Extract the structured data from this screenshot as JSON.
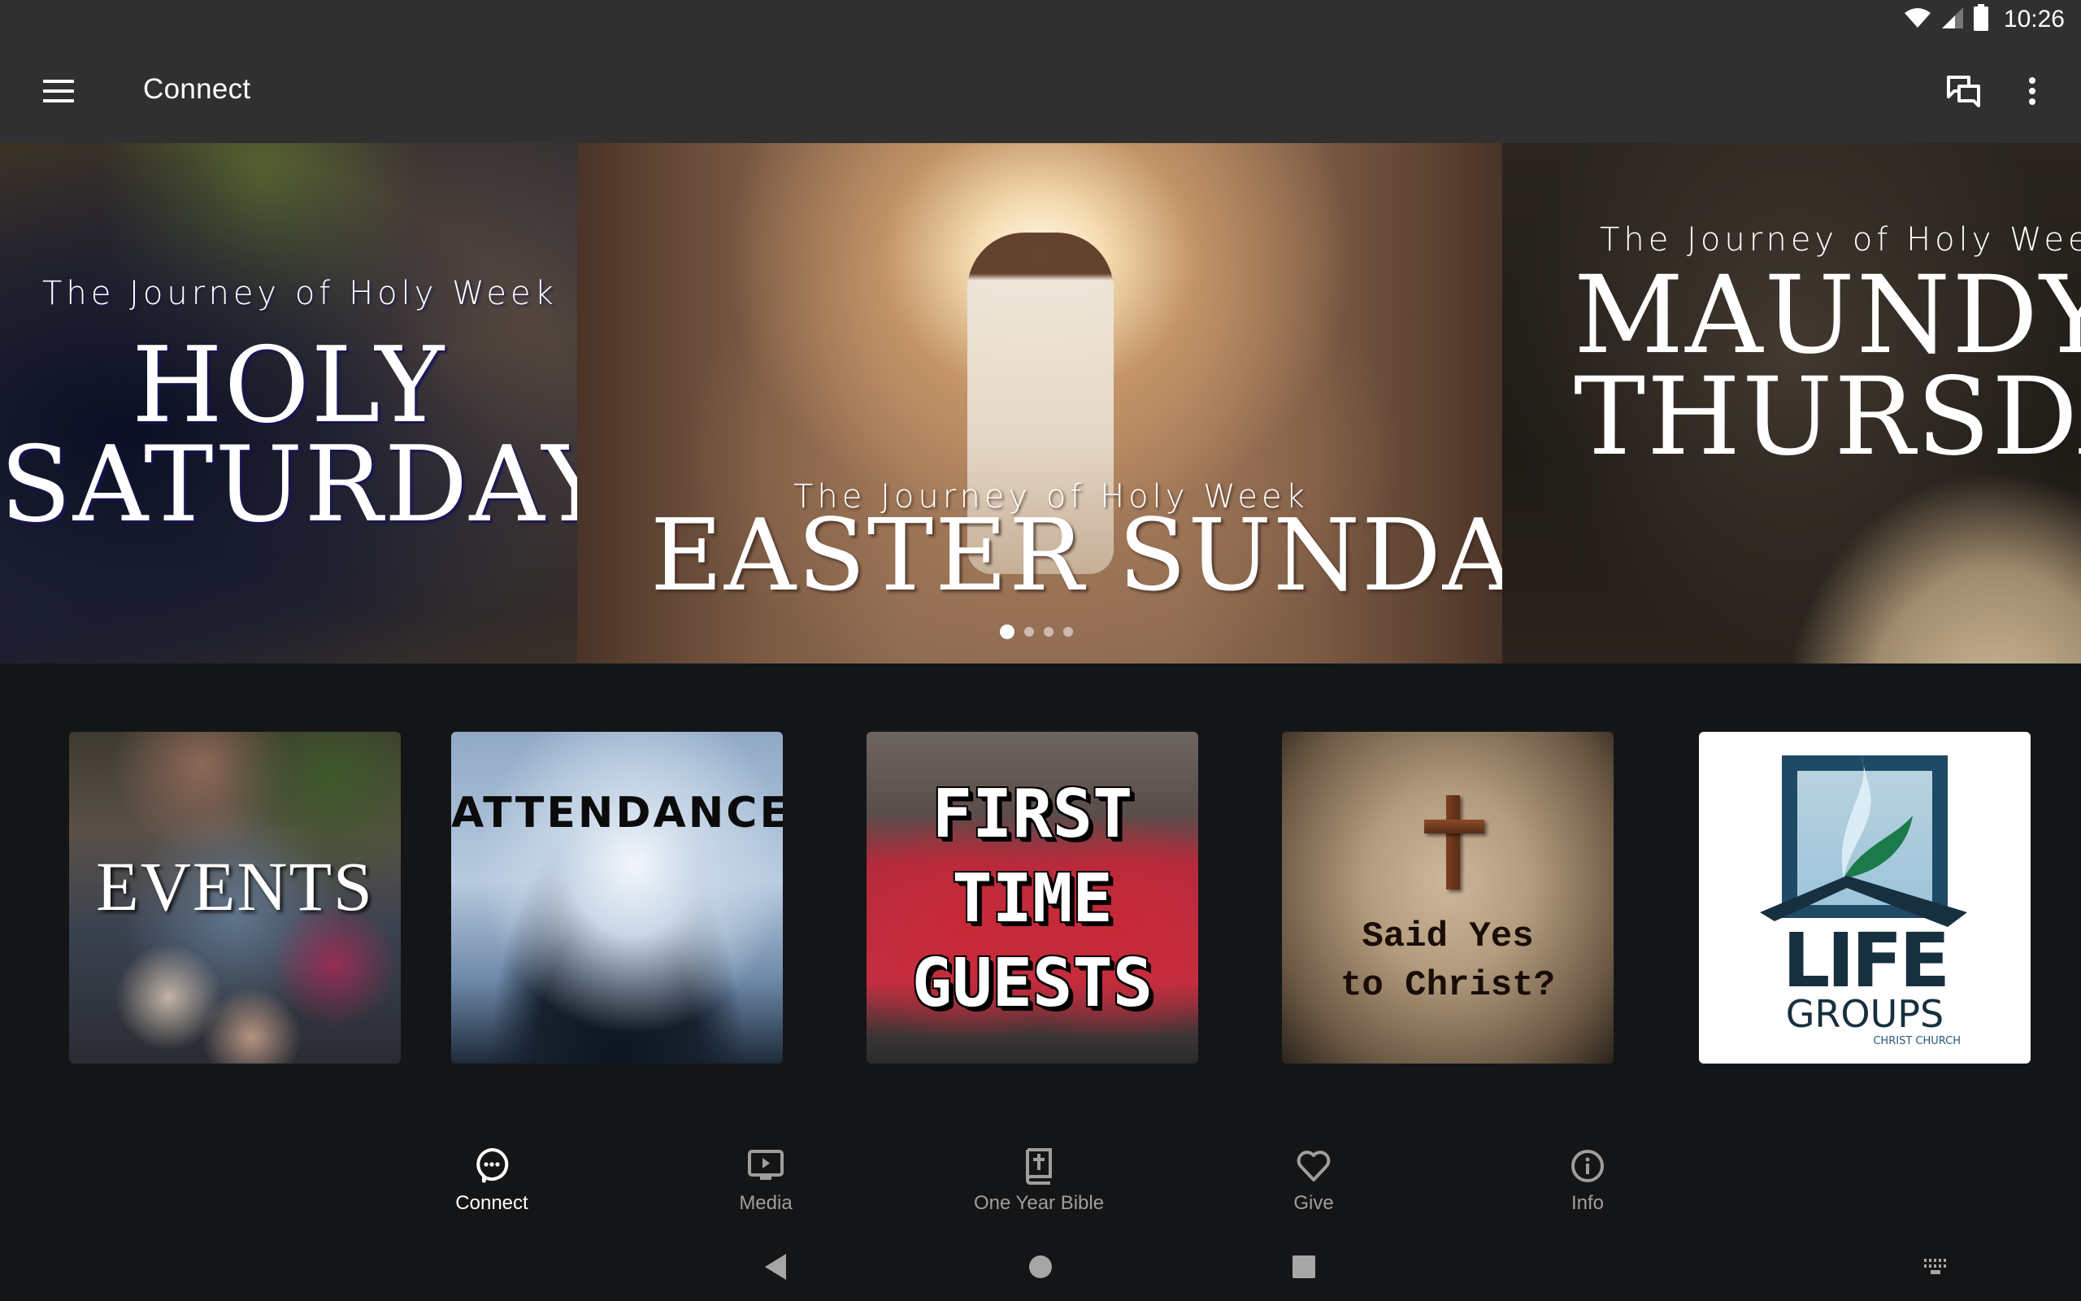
{
  "status_bar": {
    "time": "10:26",
    "icons": [
      "wifi-icon",
      "cell-signal-icon",
      "battery-icon"
    ]
  },
  "toolbar": {
    "title": "Connect",
    "menu_icon": "hamburger-menu-icon",
    "actions": [
      {
        "name": "chat",
        "icon": "chat-bubbles-icon"
      },
      {
        "name": "more-options",
        "icon": "overflow-vertical-icon"
      }
    ]
  },
  "carousel": {
    "slides": [
      {
        "kicker": "The Journey of Holy Week",
        "title_line1": "Holy",
        "title_line2": "Saturday"
      },
      {
        "kicker": "The Journey of Holy Week",
        "title_line1": "Easter Sunday",
        "title_line2": ""
      },
      {
        "kicker": "The Journey of Holy Week",
        "title_line1": "Maundy",
        "title_line2": "Thursday"
      }
    ],
    "page_count": 4,
    "active_index": 0
  },
  "tiles": [
    {
      "id": "events",
      "text": "EVENTS"
    },
    {
      "id": "attendance",
      "text": "ATTENDANCE"
    },
    {
      "id": "first-time-guests",
      "text": "FIRST\nTIME\nGUESTS"
    },
    {
      "id": "said-yes",
      "text": "Said Yes\nto Christ?"
    },
    {
      "id": "life-groups",
      "text_main": "LIFE",
      "text_sub": "GROUPS",
      "text_org": "CHRIST CHURCH"
    }
  ],
  "colors": {
    "toolbar_bg": "#303030",
    "content_bg": "#141517",
    "nav_active": "#ffffff",
    "nav_inactive": "#9e9e9e",
    "life_groups_navy": "#163040",
    "life_groups_green": "#1b7a4a"
  },
  "bottom_nav": {
    "items": [
      {
        "label": "Connect",
        "icon": "chat-bubble-dots-icon",
        "active": true
      },
      {
        "label": "Media",
        "icon": "tv-play-icon",
        "active": false
      },
      {
        "label": "One Year Bible",
        "icon": "bible-icon",
        "active": false
      },
      {
        "label": "Give",
        "icon": "heart-icon",
        "active": false
      },
      {
        "label": "Info",
        "icon": "info-icon",
        "active": false
      }
    ]
  },
  "system_nav": {
    "buttons": [
      "back-icon",
      "home-icon",
      "recents-icon",
      "keyboard-icon"
    ]
  }
}
